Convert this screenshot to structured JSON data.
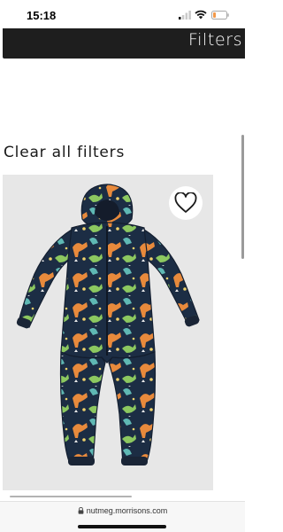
{
  "status_bar": {
    "time": "15:18",
    "icons": [
      "signal-icon",
      "wifi-icon",
      "battery-icon"
    ]
  },
  "header": {
    "filters_label": "Filters"
  },
  "filters": {
    "clear_all_label": "Clear all filters"
  },
  "products": [
    {
      "image_icon": "dinosaur-print-puddle-suit-image",
      "wishlist_icon": "heart-icon"
    }
  ],
  "browser": {
    "url": "nutmeg.morrisons.com",
    "lock_icon": "lock-icon"
  },
  "colors": {
    "filters_bar_bg": "#1e1e1e",
    "card_bg": "#e7e7e7",
    "battery_level": "#f2994a"
  }
}
